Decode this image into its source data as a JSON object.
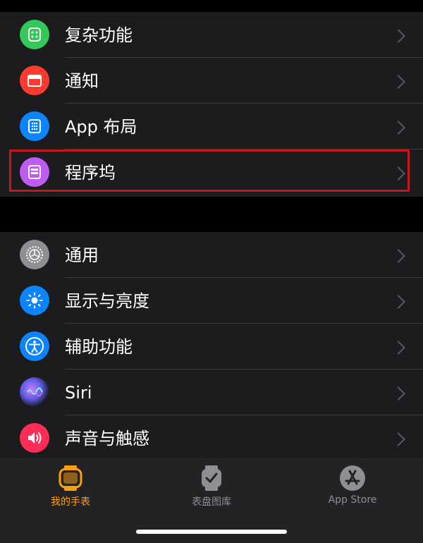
{
  "settings": {
    "group1": [
      {
        "label": "复杂功能",
        "icon": "complications-icon",
        "color": "#34c759"
      },
      {
        "label": "通知",
        "icon": "notifications-icon",
        "color": "#ff3b30"
      },
      {
        "label": "App 布局",
        "icon": "app-layout-icon",
        "color": "#0a84ff"
      },
      {
        "label": "程序坞",
        "icon": "dock-icon",
        "color": "#bf5af2"
      }
    ],
    "group2": [
      {
        "label": "通用",
        "icon": "gear-icon",
        "color": "#8e8e93"
      },
      {
        "label": "显示与亮度",
        "icon": "brightness-icon",
        "color": "#0a84ff"
      },
      {
        "label": "辅助功能",
        "icon": "accessibility-icon",
        "color": "#0a84ff"
      },
      {
        "label": "Siri",
        "icon": "siri-icon",
        "color": "#1c1c1e"
      },
      {
        "label": "声音与触感",
        "icon": "sounds-icon",
        "color": "#ff2d55"
      }
    ]
  },
  "tabs": [
    {
      "label": "我的手表",
      "icon": "my-watch-icon",
      "active": true,
      "color": "#ff9f0a"
    },
    {
      "label": "表盘图库",
      "icon": "face-gallery-icon",
      "active": false,
      "color": "#8e8e93"
    },
    {
      "label": "App Store",
      "icon": "app-store-icon",
      "active": false,
      "color": "#8e8e93"
    }
  ],
  "highlight_color": "#c4161c"
}
